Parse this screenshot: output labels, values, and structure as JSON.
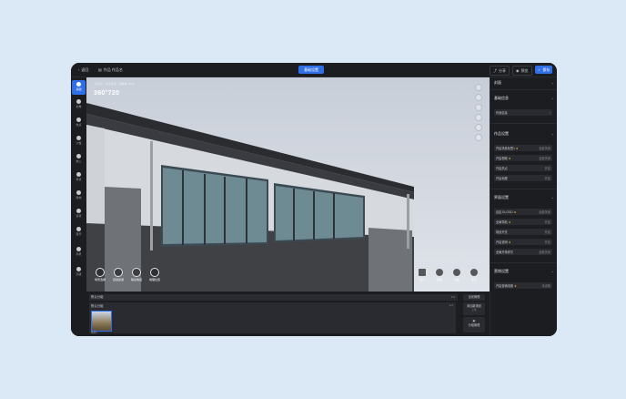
{
  "topbar": {
    "back_label": "返回",
    "title_label": "作品 作品名",
    "center_label": "基础设置",
    "preview_label": "分享",
    "share_label": "预览",
    "save_label": "保存"
  },
  "left_sidebar": {
    "items": [
      {
        "label": "基础",
        "icon": "home-icon",
        "active": true
      },
      {
        "label": "视角",
        "icon": "eye-icon"
      },
      {
        "label": "热点",
        "icon": "target-icon"
      },
      {
        "label": "沙盘",
        "icon": "map-icon"
      },
      {
        "label": "嵌入",
        "icon": "pin-icon"
      },
      {
        "label": "导览",
        "icon": "route-icon"
      },
      {
        "label": "特效",
        "icon": "sparkle-icon"
      },
      {
        "label": "遮罩",
        "icon": "mask-icon"
      },
      {
        "label": "音乐",
        "icon": "music-icon"
      },
      {
        "label": "手机",
        "icon": "phone-icon"
      },
      {
        "label": "高级",
        "icon": "settings-icon"
      }
    ]
  },
  "viewer": {
    "logo": "360°720",
    "breadcrumb": "场景名 · 场景名称 · 观看量: 6143",
    "bottom_left_tools": [
      {
        "label": "场景选择",
        "icon": "scenes-icon"
      },
      {
        "label": "自动巡游",
        "icon": "tour-icon"
      },
      {
        "label": "联系电话",
        "icon": "phone-icon"
      },
      {
        "label": "地理位置",
        "icon": "location-icon"
      }
    ],
    "bottom_right_tools": [
      {
        "label": "简介",
        "icon": "info-icon"
      },
      {
        "label": "说明",
        "icon": "doc-icon"
      },
      {
        "label": "点赞",
        "icon": "heart-icon"
      },
      {
        "label": "评论",
        "icon": "comment-icon"
      }
    ]
  },
  "bottom_panel": {
    "group_label": "默认分组",
    "group_count": "1/1",
    "scene_label": "默认分组",
    "scene_count": "1/1",
    "scene_thumb_label": "场景1",
    "btn_scene_mgmt": "全景管理",
    "btn_add_scene": "添加新场景",
    "btn_add_scene_sub": "上传",
    "btn_group_settings": "分组管理"
  },
  "right_panel": {
    "sections": [
      {
        "title": "封面",
        "rows": []
      },
      {
        "title": "基础信息",
        "rows": [
          {
            "label": "作品信息",
            "value": ""
          }
        ]
      },
      {
        "title": "作品设置",
        "rows": [
          {
            "label": "开启场景标签1",
            "value": "全部关闭",
            "vip": true
          },
          {
            "label": "开启视频",
            "value": "全部关闭",
            "vip": true
          },
          {
            "label": "开启热点",
            "value": "开启"
          },
          {
            "label": "开启地理",
            "value": "开启"
          }
        ]
      },
      {
        "title": "界面设置",
        "rows": [
          {
            "label": "自定义LOGO",
            "value": "全部关闭",
            "vip": true
          },
          {
            "label": "全局导航",
            "value": "开启",
            "vip": true
          },
          {
            "label": "场景开关",
            "value": "开启"
          },
          {
            "label": "开启说明",
            "value": "开启",
            "vip": true
          },
          {
            "label": "全局开场样式",
            "value": "全部关闭"
          }
        ]
      },
      {
        "title": "营销设置",
        "rows": [
          {
            "label": "开启营销设置",
            "value": "未设置",
            "vip": true
          }
        ]
      }
    ]
  },
  "colors": {
    "accent": "#2f6fe8",
    "panel": "#1c1d21",
    "row": "#2a2b30",
    "vip": "#f0b429"
  }
}
